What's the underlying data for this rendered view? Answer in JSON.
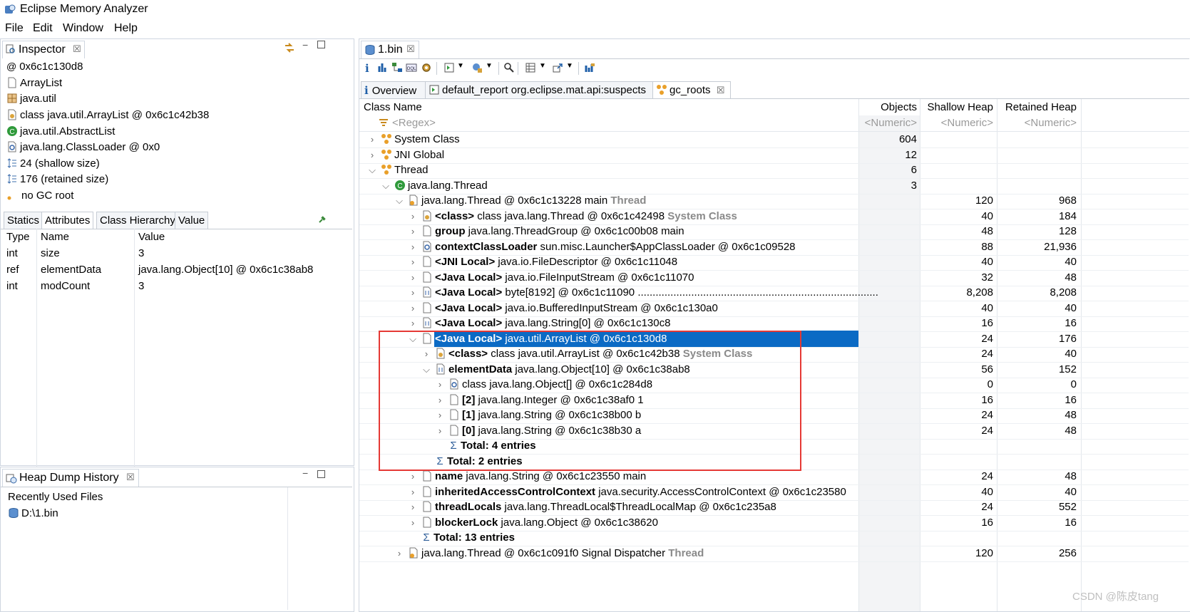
{
  "window": {
    "title": "Eclipse Memory Analyzer"
  },
  "menu": [
    "File",
    "Edit",
    "Window",
    "Help"
  ],
  "inspector": {
    "tab_label": "Inspector",
    "lines": [
      {
        "icon": "at-icon",
        "text": "0x6c1c130d8"
      },
      {
        "icon": "file-icon",
        "text": "ArrayList"
      },
      {
        "icon": "package-icon",
        "text": "java.util"
      },
      {
        "icon": "class-icon",
        "text": "class java.util.ArrayList @ 0x6c1c42b38"
      },
      {
        "icon": "super-class-icon",
        "text": "java.util.AbstractList"
      },
      {
        "icon": "classloader-icon",
        "text": "java.lang.ClassLoader @ 0x0"
      },
      {
        "icon": "size-icon",
        "text": "24 (shallow size)"
      },
      {
        "icon": "size-icon",
        "text": "176 (retained size)"
      },
      {
        "icon": "gc-root-icon",
        "text": "no GC root"
      }
    ],
    "tabs": [
      "Statics",
      "Attributes",
      "Class Hierarchy",
      "Value"
    ],
    "selected_tab": "Attributes",
    "columns": [
      "Type",
      "Name",
      "Value"
    ],
    "rows": [
      [
        "int",
        "size",
        "3"
      ],
      [
        "ref",
        "elementData",
        "java.lang.Object[10] @ 0x6c1c38ab8"
      ],
      [
        "int",
        "modCount",
        "3"
      ]
    ]
  },
  "history": {
    "tab_label": "Heap Dump History",
    "heading": "Recently Used Files",
    "files": [
      "D:\\1.bin"
    ]
  },
  "editor": {
    "tab_label": "1.bin",
    "sub_tabs": [
      "Overview",
      "default_report  org.eclipse.mat.api:suspects",
      "gc_roots"
    ],
    "selected_sub_tab": "gc_roots",
    "columns": [
      "Class Name",
      "Objects",
      "Shallow Heap",
      "Retained Heap"
    ],
    "filter_row": [
      "<Regex>",
      "<Numeric>",
      "<Numeric>",
      "<Numeric>"
    ],
    "rows": [
      {
        "indent": 0,
        "chev": ">",
        "icon": "group-icon",
        "bold": "",
        "name": "System Class",
        "suffix": "",
        "objects": "604",
        "shallow": "",
        "retained": ""
      },
      {
        "indent": 0,
        "chev": ">",
        "icon": "group-icon",
        "bold": "",
        "name": "JNI Global",
        "suffix": "",
        "objects": "12",
        "shallow": "",
        "retained": ""
      },
      {
        "indent": 0,
        "chev": "v",
        "icon": "group-icon",
        "bold": "",
        "name": "Thread",
        "suffix": "",
        "objects": "6",
        "shallow": "",
        "retained": ""
      },
      {
        "indent": 1,
        "chev": "v",
        "icon": "class-icon",
        "bold": "",
        "name": "java.lang.Thread",
        "suffix": "",
        "objects": "3",
        "shallow": "",
        "retained": ""
      },
      {
        "indent": 2,
        "chev": "v",
        "icon": "thread-icon",
        "bold": "",
        "name": "java.lang.Thread @ 0x6c1c13228  main",
        "suffix": "Thread",
        "objects": "",
        "shallow": "120",
        "retained": "968"
      },
      {
        "indent": 3,
        "chev": ">",
        "icon": "class-obj-icon",
        "bold": "<class>",
        "name": " class java.lang.Thread @ 0x6c1c42498",
        "suffix": "System Class",
        "objects": "",
        "shallow": "40",
        "retained": "184"
      },
      {
        "indent": 3,
        "chev": ">",
        "icon": "file-icon",
        "bold": "group",
        "name": " java.lang.ThreadGroup @ 0x6c1c00b08  main",
        "suffix": "",
        "objects": "",
        "shallow": "48",
        "retained": "128"
      },
      {
        "indent": 3,
        "chev": ">",
        "icon": "classloader-icon",
        "bold": "contextClassLoader",
        "name": " sun.misc.Launcher$AppClassLoader @ 0x6c1c09528",
        "suffix": "",
        "objects": "",
        "shallow": "88",
        "retained": "21,936"
      },
      {
        "indent": 3,
        "chev": ">",
        "icon": "file-icon",
        "bold": "<JNI Local>",
        "name": " java.io.FileDescriptor @ 0x6c1c11048",
        "suffix": "",
        "objects": "",
        "shallow": "40",
        "retained": "40"
      },
      {
        "indent": 3,
        "chev": ">",
        "icon": "file-icon",
        "bold": "<Java Local>",
        "name": " java.io.FileInputStream @ 0x6c1c11070",
        "suffix": "",
        "objects": "",
        "shallow": "32",
        "retained": "48"
      },
      {
        "indent": 3,
        "chev": ">",
        "icon": "array-icon",
        "bold": "<Java Local>",
        "name": " byte[8192] @ 0x6c1c11090  .................................................................................",
        "suffix": "",
        "objects": "",
        "shallow": "8,208",
        "retained": "8,208"
      },
      {
        "indent": 3,
        "chev": ">",
        "icon": "file-icon",
        "bold": "<Java Local>",
        "name": " java.io.BufferedInputStream @ 0x6c1c130a0",
        "suffix": "",
        "objects": "",
        "shallow": "40",
        "retained": "40"
      },
      {
        "indent": 3,
        "chev": ">",
        "icon": "array-icon",
        "bold": "<Java Local>",
        "name": " java.lang.String[0] @ 0x6c1c130c8",
        "suffix": "",
        "objects": "",
        "shallow": "16",
        "retained": "16"
      },
      {
        "indent": 3,
        "chev": "v",
        "icon": "file-icon",
        "bold": "<Java Local>",
        "name": " java.util.ArrayList @ 0x6c1c130d8",
        "suffix": "",
        "objects": "",
        "shallow": "24",
        "retained": "176",
        "selected": true
      },
      {
        "indent": 4,
        "chev": ">",
        "icon": "class-obj-icon",
        "bold": "<class>",
        "name": " class java.util.ArrayList @ 0x6c1c42b38",
        "suffix": "System Class",
        "objects": "",
        "shallow": "24",
        "retained": "40"
      },
      {
        "indent": 4,
        "chev": "v",
        "icon": "array-icon",
        "bold": "elementData",
        "name": " java.lang.Object[10] @ 0x6c1c38ab8",
        "suffix": "",
        "objects": "",
        "shallow": "56",
        "retained": "152"
      },
      {
        "indent": 5,
        "chev": ">",
        "icon": "classloader-icon",
        "bold": "",
        "name": "class java.lang.Object[] @ 0x6c1c284d8",
        "suffix": "",
        "objects": "",
        "shallow": "0",
        "retained": "0"
      },
      {
        "indent": 5,
        "chev": ">",
        "icon": "file-icon",
        "bold": "[2]",
        "name": " java.lang.Integer @ 0x6c1c38af0  1",
        "suffix": "",
        "objects": "",
        "shallow": "16",
        "retained": "16"
      },
      {
        "indent": 5,
        "chev": ">",
        "icon": "file-icon",
        "bold": "[1]",
        "name": " java.lang.String @ 0x6c1c38b00  b",
        "suffix": "",
        "objects": "",
        "shallow": "24",
        "retained": "48"
      },
      {
        "indent": 5,
        "chev": ">",
        "icon": "file-icon",
        "bold": "[0]",
        "name": " java.lang.String @ 0x6c1c38b30  a",
        "suffix": "",
        "objects": "",
        "shallow": "24",
        "retained": "48"
      },
      {
        "indent": 5,
        "chev": "",
        "icon": "sum-icon",
        "bold": "Total: 4 entries",
        "name": "",
        "suffix": "",
        "objects": "",
        "shallow": "",
        "retained": ""
      },
      {
        "indent": 4,
        "chev": "",
        "icon": "sum-icon",
        "bold": "Total: 2 entries",
        "name": "",
        "suffix": "",
        "objects": "",
        "shallow": "",
        "retained": ""
      },
      {
        "indent": 3,
        "chev": ">",
        "icon": "file-icon",
        "bold": "name",
        "name": " java.lang.String @ 0x6c1c23550  main",
        "suffix": "",
        "objects": "",
        "shallow": "24",
        "retained": "48"
      },
      {
        "indent": 3,
        "chev": ">",
        "icon": "file-icon",
        "bold": "inheritedAccessControlContext",
        "name": " java.security.AccessControlContext @ 0x6c1c23580",
        "suffix": "",
        "objects": "",
        "shallow": "40",
        "retained": "40"
      },
      {
        "indent": 3,
        "chev": ">",
        "icon": "file-icon",
        "bold": "threadLocals",
        "name": " java.lang.ThreadLocal$ThreadLocalMap @ 0x6c1c235a8",
        "suffix": "",
        "objects": "",
        "shallow": "24",
        "retained": "552"
      },
      {
        "indent": 3,
        "chev": ">",
        "icon": "file-icon",
        "bold": "blockerLock",
        "name": " java.lang.Object @ 0x6c1c38620",
        "suffix": "",
        "objects": "",
        "shallow": "16",
        "retained": "16"
      },
      {
        "indent": 3,
        "chev": "",
        "icon": "sum-icon",
        "bold": "Total: 13 entries",
        "name": "",
        "suffix": "",
        "objects": "",
        "shallow": "",
        "retained": ""
      },
      {
        "indent": 2,
        "chev": ">",
        "icon": "thread-icon",
        "bold": "",
        "name": "java.lang.Thread @ 0x6c1c091f0  Signal Dispatcher",
        "suffix": "Thread",
        "objects": "",
        "shallow": "120",
        "retained": "256"
      }
    ]
  },
  "watermark": "CSDN @陈皮tang"
}
